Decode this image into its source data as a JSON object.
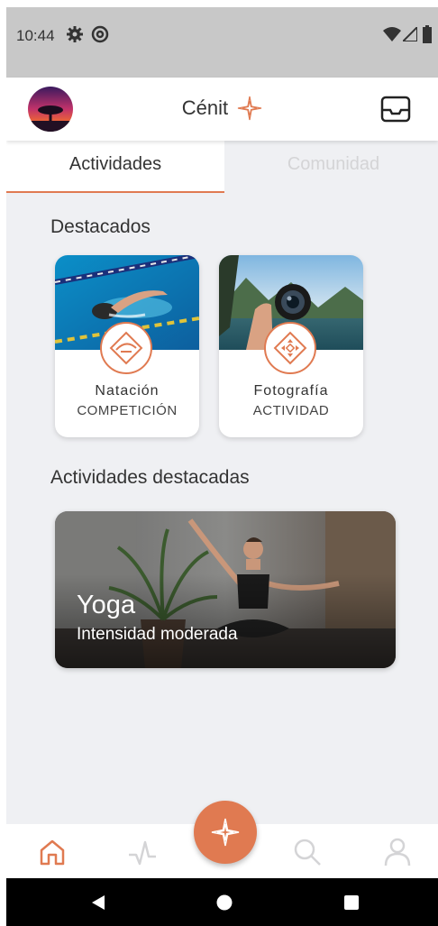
{
  "status_bar": {
    "time": "10:44"
  },
  "header": {
    "brand": "Cénit"
  },
  "tabs": [
    {
      "label": "Actividades",
      "active": true
    },
    {
      "label": "Comunidad",
      "active": false
    }
  ],
  "featured": {
    "title": "Destacados",
    "cards": [
      {
        "title": "Natación",
        "subtitle": "COMPETICIÓN",
        "icon": "swim-wave-icon"
      },
      {
        "title": "Fotografía",
        "subtitle": "ACTIVIDAD",
        "icon": "focus-diamond-icon"
      }
    ]
  },
  "activities": {
    "title": "Actividades destacadas",
    "item": {
      "title": "Yoga",
      "subtitle": "Intensidad moderada"
    }
  },
  "bottom_nav": {
    "items": [
      "home-icon",
      "activity-pulse-icon",
      "compass-star-icon",
      "search-icon",
      "profile-icon"
    ],
    "active": "home-icon"
  },
  "colors": {
    "accent": "#e07a51",
    "background": "#eff0f3"
  }
}
